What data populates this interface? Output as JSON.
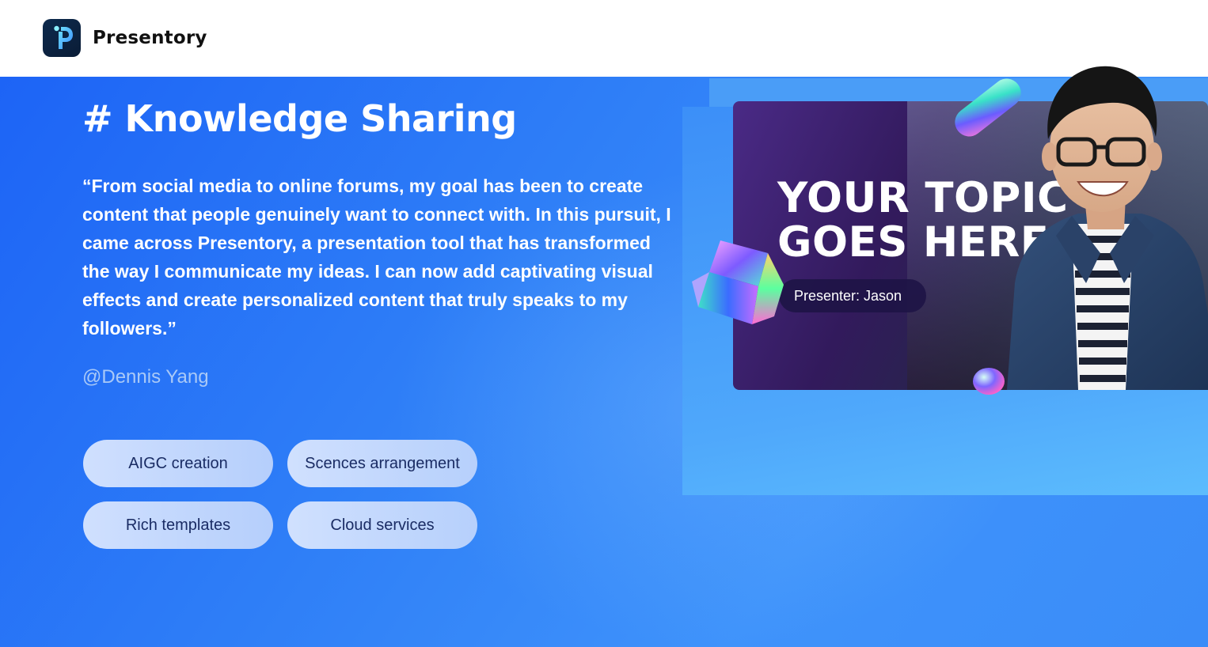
{
  "header": {
    "brand_name": "Presentory",
    "logo_icon": "presentory-logo-icon"
  },
  "hero": {
    "heading": "# Knowledge Sharing",
    "quote": "“From social media to online forums, my goal has been to create content that people genuinely want to connect with. In this pursuit, I came across Presentory, a presentation tool that has transformed the way I communicate my ideas. I can now add captivating visual effects and create personalized content that truly speaks to my followers.”",
    "author": "@Dennis Yang",
    "features": [
      {
        "label": "AIGC creation"
      },
      {
        "label": "Scences arrangement"
      },
      {
        "label": "Rich templates"
      },
      {
        "label": "Cloud services"
      }
    ],
    "colors": {
      "background_start": "#1d64f6",
      "background_end": "#3f93fb",
      "pill_text": "#1a2c64"
    }
  },
  "preview": {
    "slide_title": "YOUR TOPIC GOES HERE",
    "presenter_label": "Presenter: Jason",
    "decorations": [
      "iridescent-cube-icon",
      "iridescent-capsule-icon",
      "iridescent-orb-icon"
    ]
  }
}
